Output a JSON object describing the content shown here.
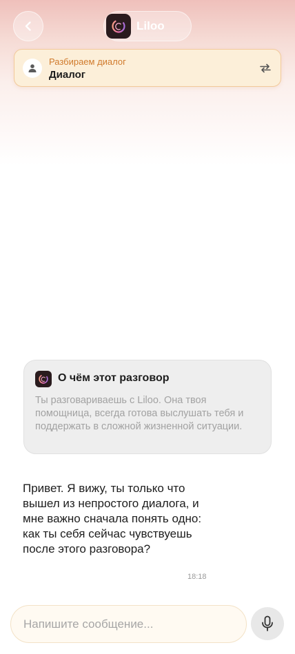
{
  "header": {
    "back_icon": "chevron-left-icon",
    "app_logo_icon": "liloo-logo-icon",
    "title": "Liloo"
  },
  "banner": {
    "avatar_icon": "person-icon",
    "subtitle": "Разбираем диалог",
    "title": "Диалог",
    "swap_icon": "swap-arrows-icon",
    "accent_color": "#d07a2c"
  },
  "info_card": {
    "logo_icon": "liloo-logo-icon",
    "title": "О чём этот разговор",
    "text": "Ты разговариваешь с Liloo. Она твоя помощница, всегда готова выслушать тебя и поддержать в сложной жизненной ситуации."
  },
  "message": {
    "text": "Привет. Я вижу, ты только что вышел из непростого диалога, и мне важно сначала понять одно: как ты себя сейчас чувствуешь после этого разговора?",
    "time": "18:18"
  },
  "composer": {
    "placeholder": "Напишите сообщение...",
    "mic_icon": "microphone-icon"
  }
}
